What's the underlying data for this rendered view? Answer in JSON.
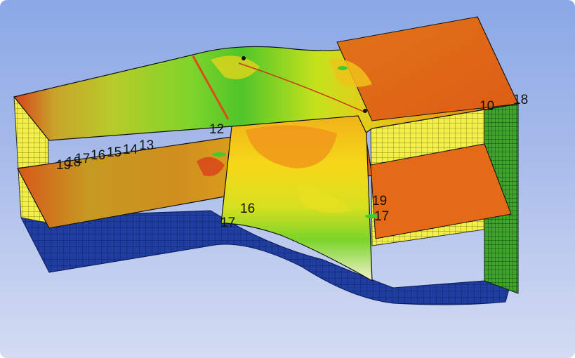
{
  "viewer": {
    "content": "3d-cascade-passage-contour-plot",
    "background_top": "#8aa8e6",
    "background_bottom": "#d4dcf3"
  },
  "colors": {
    "mesh_blue": "#1f3ea0",
    "mesh_yellow": "#f2ef4a",
    "contour_orange": "#e0661a",
    "contour_green": "#4fc52a",
    "contour_yellow": "#e8e021"
  },
  "contour_labels": {
    "upper_left_row": [
      "13",
      "14",
      "15",
      "16",
      "17",
      "18",
      "19"
    ],
    "hub_row": [
      "12"
    ],
    "right_face": [
      "10",
      "18"
    ],
    "blade_suction_side": [
      "19",
      "17",
      "16",
      "17"
    ]
  }
}
